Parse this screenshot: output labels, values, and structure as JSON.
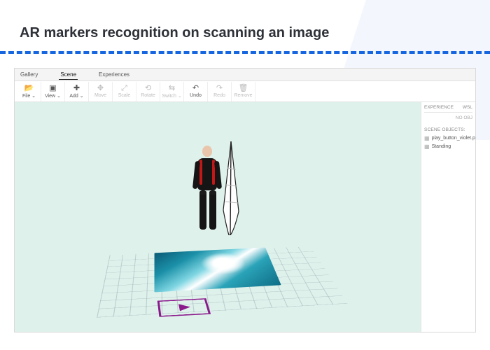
{
  "page_title": "AR markers recognition on scanning an image",
  "tabs": {
    "gallery": "Gallery",
    "scene": "Scene",
    "experiences": "Experiences"
  },
  "toolbar": {
    "file": "File ⌄",
    "view": "View ⌄",
    "add": "Add ⌄",
    "move": "Move",
    "scale": "Scale",
    "rotate": "Rotate",
    "switch": "Switch ⌄",
    "undo": "Undo",
    "redo": "Redo",
    "remove": "Remove"
  },
  "sidepanel": {
    "tab_experience": "EXPERIENCE",
    "tab_wsl": "WSL",
    "no_obj": "NO OBJ",
    "section": "SCENE OBJECTS:",
    "items": [
      "play_button_violet.png",
      "Standing"
    ]
  }
}
